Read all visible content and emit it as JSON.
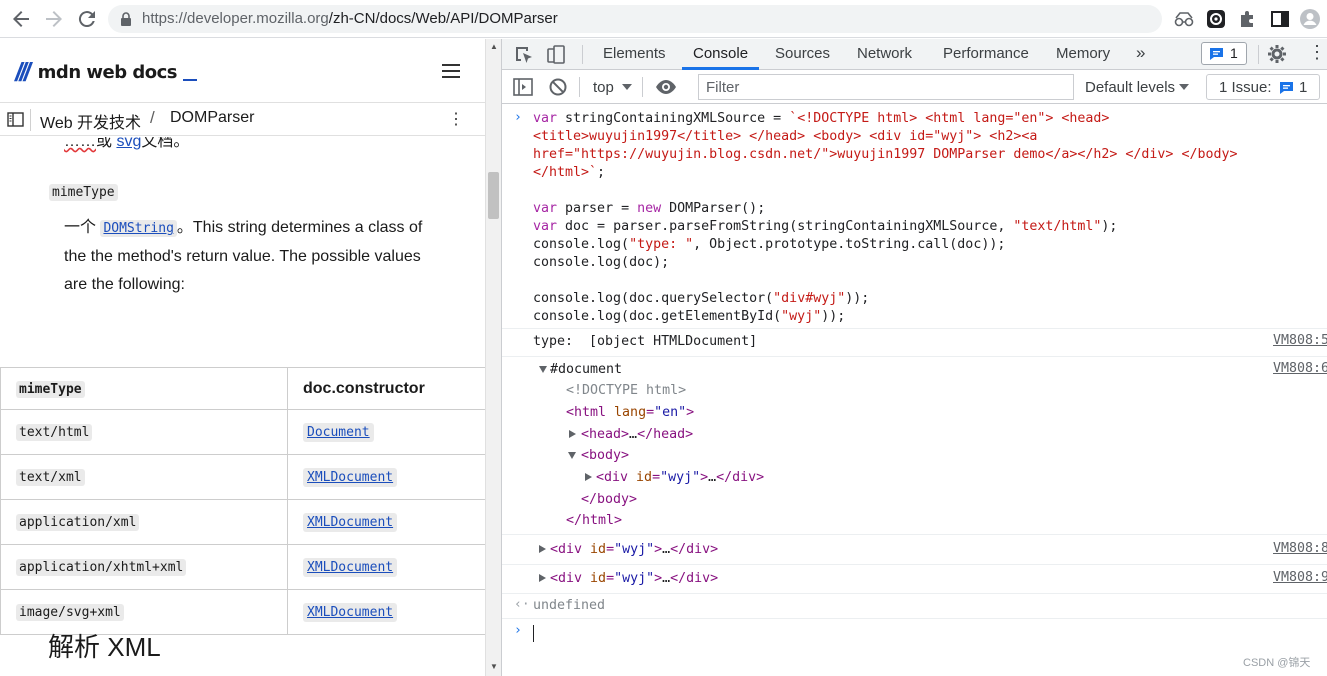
{
  "browser": {
    "url_host": "https://developer.mozilla.org",
    "url_path": "/zh-CN/docs/Web/API/DOMParser"
  },
  "mdn": {
    "logo_text": "mdn web docs",
    "breadcrumb": [
      "Web 开发技术",
      "DOMParser"
    ],
    "cut_line": {
      "squiggle": "……",
      "middle": "或 ",
      "link": "svg",
      "tail": "文档。"
    },
    "term": "mimeType",
    "para": {
      "prefix": "一个 ",
      "link": "DOMString",
      "text": "。This string determines a class of the the method's return value. The possible values are the following:"
    },
    "table": {
      "headers": [
        "mimeType",
        "doc.constructor"
      ],
      "rows": [
        [
          "text/html",
          "Document"
        ],
        [
          "text/xml",
          "XMLDocument"
        ],
        [
          "application/xml",
          "XMLDocument"
        ],
        [
          "application/xhtml+xml",
          "XMLDocument"
        ],
        [
          "image/svg+xml",
          "XMLDocument"
        ]
      ]
    },
    "heading": "解析 XML"
  },
  "devtools": {
    "tabs": [
      "Elements",
      "Console",
      "Sources",
      "Network",
      "Performance",
      "Memory"
    ],
    "active_tab": "Console",
    "message_count": "1",
    "console_toolbar": {
      "context": "top",
      "filter_placeholder": "Filter",
      "levels": "Default levels",
      "issues_label": "1 Issue:",
      "issues_count": "1"
    },
    "log": {
      "type_prefix": "type:  ",
      "type_value": "[object HTMLDocument]",
      "sources": [
        "VM808:5",
        "VM808:6",
        "VM808:8",
        "VM808:9"
      ],
      "result": "undefined"
    }
  },
  "watermark": "CSDN @锦天",
  "colors": {
    "accent": "#1a73e8",
    "mdn_blue": "#1b4ebc"
  }
}
